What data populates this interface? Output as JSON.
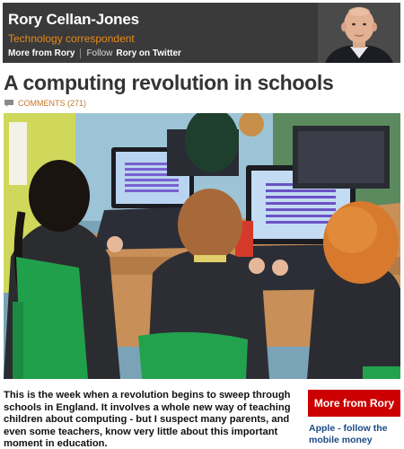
{
  "header": {
    "author_name": "Rory Cellan-Jones",
    "role": "Technology correspondent",
    "more_link": "More from Rory",
    "follow_prefix": "Follow",
    "twitter_link": "Rory on Twitter",
    "bg_color": "#3a3a3a",
    "role_color": "#e88a1a"
  },
  "article": {
    "headline": "A computing revolution in schools",
    "comments_label": "COMMENTS (271)",
    "comments_icon": "speech-bubble-icon",
    "body": "This is the week when a revolution begins to sweep through schools in England. It involves a whole new way of teaching children about computing - but I suspect many parents, and even some teachers, know very little about this important moment in education."
  },
  "sidebar": {
    "more_button": "More from Rory",
    "related_link": "Apple - follow the mobile money",
    "button_color": "#cc0000",
    "link_color": "#1a4a85"
  }
}
